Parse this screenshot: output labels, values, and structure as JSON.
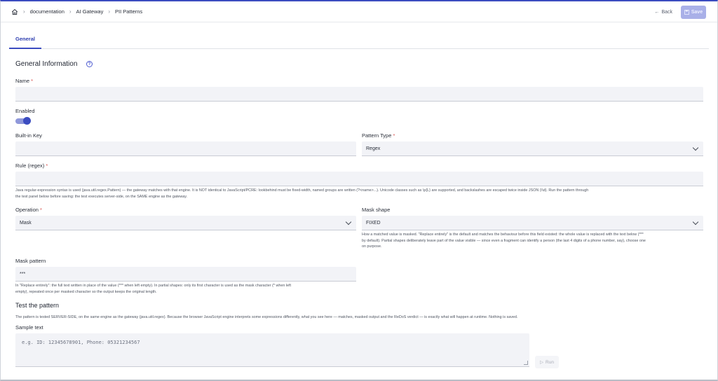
{
  "breadcrumbs": [
    "documentation",
    "AI Gateway",
    "PII Patterns"
  ],
  "actions": {
    "back_label": "Back",
    "save_label": "Save"
  },
  "tabs": [
    {
      "label": "General"
    }
  ],
  "general": {
    "title": "General Information",
    "name_label": "Name",
    "name_value": "",
    "enabled_label": "Enabled",
    "enabled": true,
    "builtin_key_label": "Built-in Key",
    "builtin_key_value": "",
    "pattern_type_label": "Pattern Type",
    "pattern_type_value": "Regex",
    "rule_label": "Rule (regex)",
    "rule_value": "",
    "rule_hint_1": "Java regular-expression syntax is used (java.util.regex.Pattern) — the gateway matches with that engine. It is NOT identical to JavaScript/PCRE: lookbehind must be fixed-width, named groups are written (?<name>...). Unicode classes such as \\p{L} are supported, and backslashes are escaped twice inside JSON (\\\\d). Run the pattern through",
    "rule_hint_2": "the test panel below before saving: the test executes server-side, on the SAME engine as the gateway.",
    "operation_label": "Operation",
    "operation_value": "Mask",
    "mask_shape_label": "Mask shape",
    "mask_shape_value": "FIXED",
    "mask_shape_hint_1": "How a matched value is masked. \"Replace entirely\" is the default and matches the behaviour before this field existed: the whole value is replaced with the text below (***",
    "mask_shape_hint_2": "by default). Partial shapes deliberately leave part of the value visible — since even a fragment can identify a person (the last 4 digits of a phone number, say), choose one",
    "mask_shape_hint_3": "on purpose.",
    "mask_pattern_label": "Mask pattern",
    "mask_pattern_value": "***",
    "mask_pattern_hint_1": "In \"Replace entirely\": the full text written in place of the value (*** when left empty). In partial shapes: only its first character is used as the mask character (* when left",
    "mask_pattern_hint_2": "empty), repeated once per masked character so the output keeps the original length."
  },
  "test": {
    "title": "Test the pattern",
    "hint": "The pattern is tested SERVER-SIDE, on the same engine as the gateway (java.util.regex). Because the browser JavaScript engine interprets some expressions differently, what you see here — matches, masked output and the ReDoS verdict — is exactly what will happen at runtime. Nothing is saved.",
    "sample_label": "Sample text",
    "sample_placeholder": "e.g. ID: 12345678901, Phone: 05321234567",
    "run_label": "Run"
  },
  "colors": {
    "accent": "#3b4cc0",
    "required": "#d9534f",
    "field_bg": "#f2f3f7"
  }
}
